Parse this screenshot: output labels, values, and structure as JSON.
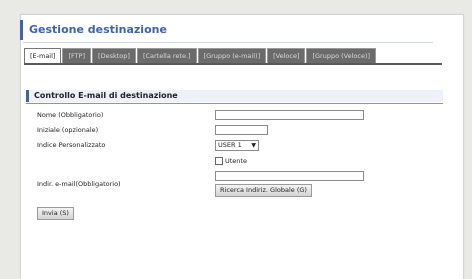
{
  "header": {
    "title": "Gestione destinazione"
  },
  "tabs": [
    {
      "label": "[E-mail]",
      "active": true
    },
    {
      "label": "[FTP]"
    },
    {
      "label": "[Desktop]"
    },
    {
      "label": "[Cartella rete.]"
    },
    {
      "label": "[Gruppo (e-mail)]"
    },
    {
      "label": "[Veloce]"
    },
    {
      "label": "[Gruppo (Veloce)]"
    }
  ],
  "section": {
    "title": "Controllo E-mail di destinazione"
  },
  "form": {
    "name_label": "Nome (Obbligatorio)",
    "name_value": "",
    "initial_label": "Iniziale (opzionale)",
    "initial_value": "",
    "index_label": "Indice Personalizzato",
    "index_value": "USER 1",
    "user_checkbox_label": "Utente",
    "user_checkbox_checked": false,
    "email_label": "Indir. e-mail(Obbligatorio)",
    "email_value": "",
    "global_search_button": "Ricerca Indiriz. Globale (G)",
    "send_button": "Invia (S)"
  },
  "colors": {
    "accent": "#3d63a8",
    "tab_inactive_bg": "#6b6b6b",
    "section_bg": "#eef1f8"
  }
}
